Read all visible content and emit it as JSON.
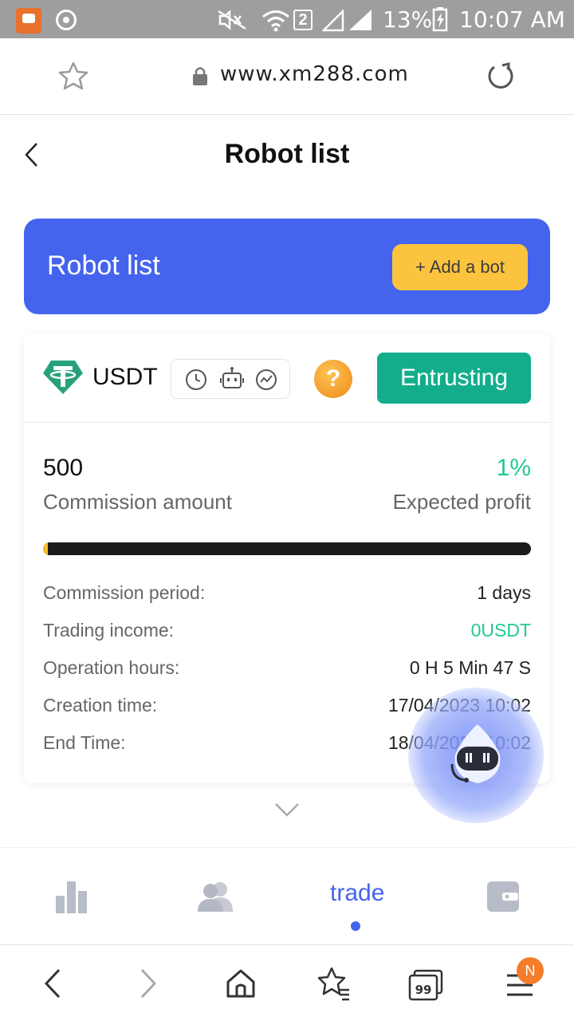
{
  "status_bar": {
    "battery": "13%",
    "sim_slot": "2",
    "time": "10:07 AM"
  },
  "browser": {
    "url": "www.xm288.com"
  },
  "header": {
    "title": "Robot list"
  },
  "banner": {
    "title": "Robot list",
    "add_button": "+ Add a bot"
  },
  "robot_card": {
    "coin": "USDT",
    "status_button": "Entrusting",
    "help_label": "?",
    "commission_amount": "500",
    "commission_amount_label": "Commission amount",
    "expected_profit": "1%",
    "expected_profit_label": "Expected profit",
    "progress_fraction": 0.01,
    "details": [
      {
        "label": "Commission period:",
        "value": "1 days"
      },
      {
        "label": "Trading income:",
        "value": "0USDT"
      },
      {
        "label": "Operation hours:",
        "value": "0 H 5 Min 47 S"
      },
      {
        "label": "Creation time:",
        "value": "17/04/2023 10:02"
      },
      {
        "label": "End Time:",
        "value": "18/04/2023 10:02"
      }
    ]
  },
  "tabs": {
    "items": [
      {
        "icon": "bar-chart-icon"
      },
      {
        "icon": "users-icon"
      },
      {
        "label": "trade",
        "active": true
      },
      {
        "icon": "wallet-icon"
      }
    ]
  },
  "browser_nav": {
    "menu_badge": "N"
  },
  "colors": {
    "banner": "#4464ee",
    "add_button": "#fcc43e",
    "entrust_button": "#14ad8b",
    "profit_green": "#22c990",
    "progress_track": "#1a1a1a",
    "progress_fill": "#fcbf2e"
  }
}
